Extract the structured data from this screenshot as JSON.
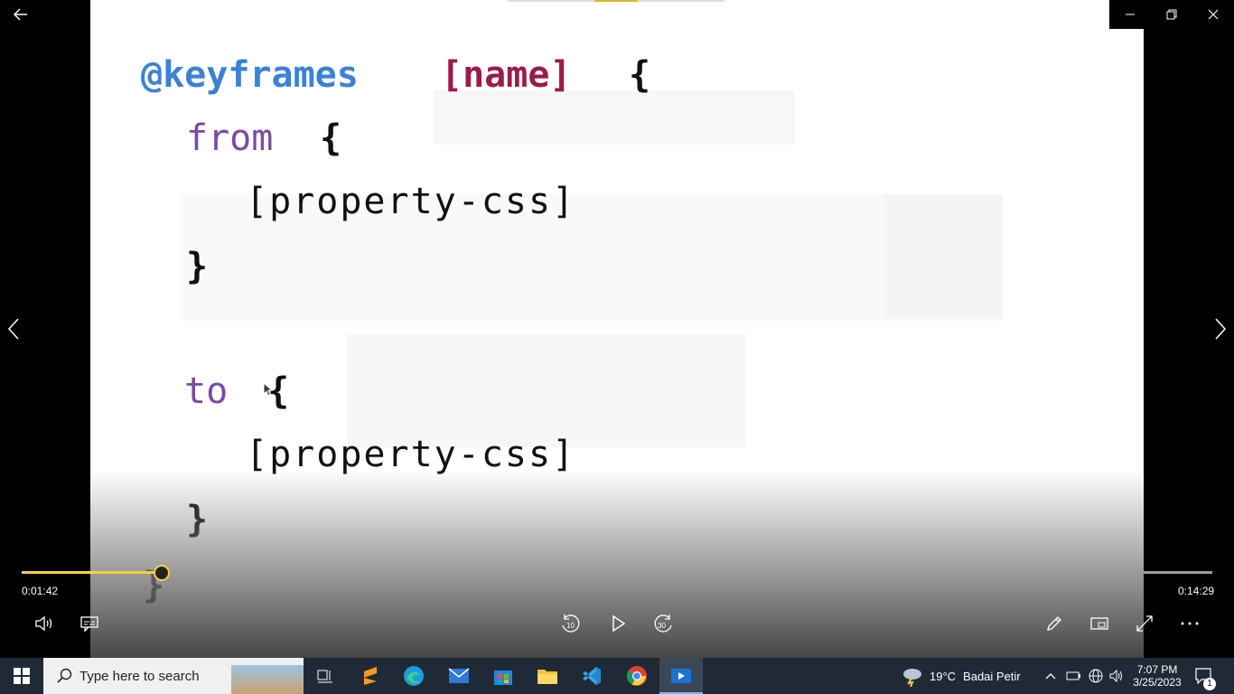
{
  "slide": {
    "line1_at": "@keyframes",
    "line1_name": "[name]",
    "line1_brace": "{",
    "from_kw": "from",
    "from_brace": "{",
    "prop1": "[property-css]",
    "close1": "}",
    "to_kw": "to",
    "to_brace": "{",
    "prop2": "[property-css]",
    "close2": "}",
    "close3": "}"
  },
  "player": {
    "current_time": "0:01:42",
    "total_time": "0:14:29",
    "progress": 0.1174,
    "skip_back_label": "10",
    "skip_forward_label": "30"
  },
  "taskbar": {
    "search_placeholder": "Type here to search",
    "weather_temp": "19°C",
    "weather_text": "Badai Petir",
    "time": "7:07 PM",
    "date": "3/25/2023",
    "notification_count": "1"
  },
  "colors": {
    "accent": "#f4d23c",
    "keyword_blue": "#3b82d6",
    "name_red": "#9c1b4a",
    "keyword_purple": "#7a4aa5",
    "taskbar": "#1f2a36"
  },
  "icons": [
    "back-arrow-icon",
    "minimize-icon",
    "restore-icon",
    "close-icon",
    "chevron-left-icon",
    "chevron-right-icon",
    "volume-icon",
    "subtitles-icon",
    "rewind-10-icon",
    "play-icon",
    "forward-30-icon",
    "pen-icon",
    "mini-view-icon",
    "fullscreen-icon",
    "more-icon",
    "windows-start-icon",
    "search-icon",
    "task-view-icon",
    "sublime-text-icon",
    "edge-icon",
    "mail-icon",
    "store-icon",
    "file-explorer-icon",
    "vscode-icon",
    "chrome-icon",
    "movies-tv-icon",
    "weather-icon",
    "chevron-up-icon",
    "battery-icon",
    "network-icon",
    "speaker-icon",
    "notification-icon"
  ]
}
